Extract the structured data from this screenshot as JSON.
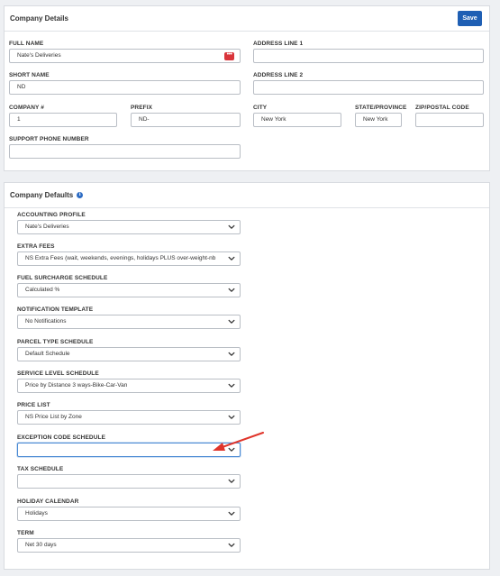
{
  "company_details": {
    "title": "Company Details",
    "save_label": "Save",
    "full_name": {
      "label": "FULL NAME",
      "value": "Nate's Deliveries"
    },
    "short_name": {
      "label": "SHORT NAME",
      "value": "ND"
    },
    "company_number": {
      "label": "COMPANY #",
      "value": "1"
    },
    "prefix": {
      "label": "PREFIX",
      "value": "ND-"
    },
    "support_phone": {
      "label": "SUPPORT PHONE NUMBER",
      "value": ""
    },
    "address_line_1": {
      "label": "ADDRESS LINE 1",
      "value": ""
    },
    "address_line_2": {
      "label": "ADDRESS LINE 2",
      "value": ""
    },
    "city": {
      "label": "CITY",
      "value": "New York"
    },
    "state": {
      "label": "STATE/PROVINCE",
      "value": "New York"
    },
    "zip": {
      "label": "ZIP/POSTAL CODE",
      "value": ""
    }
  },
  "company_defaults": {
    "title": "Company Defaults",
    "info_icon": "info-icon",
    "fields": [
      {
        "label": "ACCOUNTING PROFILE",
        "value": "Nate's Deliveries"
      },
      {
        "label": "EXTRA FEES",
        "value": "NS Extra Fees (wait, weekends, evenings, holidays PLUS over-weight-nb"
      },
      {
        "label": "FUEL SURCHARGE SCHEDULE",
        "value": "Calculated %"
      },
      {
        "label": "NOTIFICATION TEMPLATE",
        "value": "No Notifications"
      },
      {
        "label": "PARCEL TYPE SCHEDULE",
        "value": "Default Schedule"
      },
      {
        "label": "SERVICE LEVEL SCHEDULE",
        "value": "Price by Distance 3 ways-Bike-Car-Van"
      },
      {
        "label": "PRICE LIST",
        "value": "NS Price List by Zone"
      },
      {
        "label": "EXCEPTION CODE SCHEDULE",
        "value": ""
      },
      {
        "label": "TAX SCHEDULE",
        "value": ""
      },
      {
        "label": "HOLIDAY CALENDAR",
        "value": "Holidays"
      },
      {
        "label": "TERM",
        "value": "Net 30 days"
      }
    ]
  },
  "annotation": {
    "arrow_color": "#e0352b"
  }
}
